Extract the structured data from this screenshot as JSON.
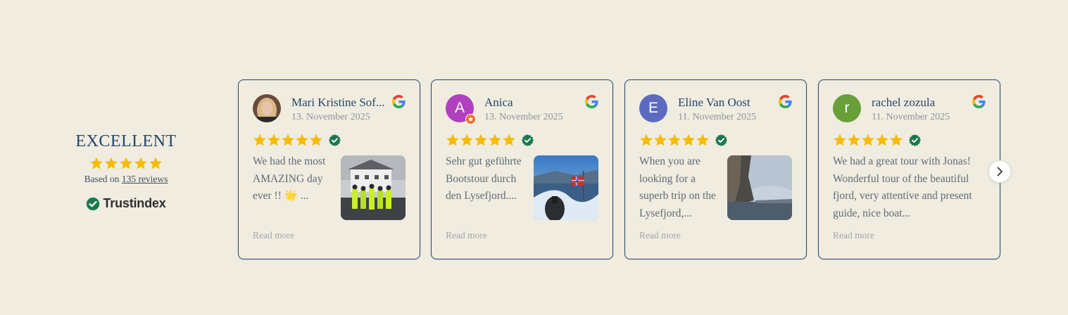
{
  "summary": {
    "rating_text": "EXCELLENT",
    "stars": 5,
    "based_prefix": "Based on",
    "reviews_link": "135 reviews",
    "brand": "Trustindex"
  },
  "colors": {
    "star": "#f6bb06",
    "accent": "#24466b",
    "verified": "#197a4f",
    "background": "#f0ecdf"
  },
  "reviews": [
    {
      "name": "Mari Kristine Sof...",
      "date": "13. November 2025",
      "text": "We had the most AMAZING day ever !! 🌟 ...",
      "read_more": "Read more",
      "source_icon": "google-icon",
      "rating": 5
    },
    {
      "name": "Anica",
      "avatar_letter": "A",
      "avatar_color": "#b040c0",
      "date": "13. November 2025",
      "text": "Sehr gut geführte Bootstour durch den Lysefjord....",
      "read_more": "Read more",
      "source_icon": "google-icon",
      "rating": 5
    },
    {
      "name": "Eline Van Oost",
      "avatar_letter": "E",
      "avatar_color": "#5c6bc0",
      "date": "11. November 2025",
      "text": "When you are looking for a superb trip on the Lysefjord,...",
      "read_more": "Read more",
      "source_icon": "google-icon",
      "rating": 5
    },
    {
      "name": "rachel zozula",
      "avatar_letter": "r",
      "avatar_color": "#689f38",
      "date": "11. November 2025",
      "text": "We had a great tour with Jonas! Wonderful tour of the beautiful fjord, very attentive and present guide, nice boat...",
      "read_more": "Read more",
      "source_icon": "google-icon",
      "rating": 5
    }
  ],
  "navigation": {
    "next_icon": "chevron-right-icon"
  }
}
